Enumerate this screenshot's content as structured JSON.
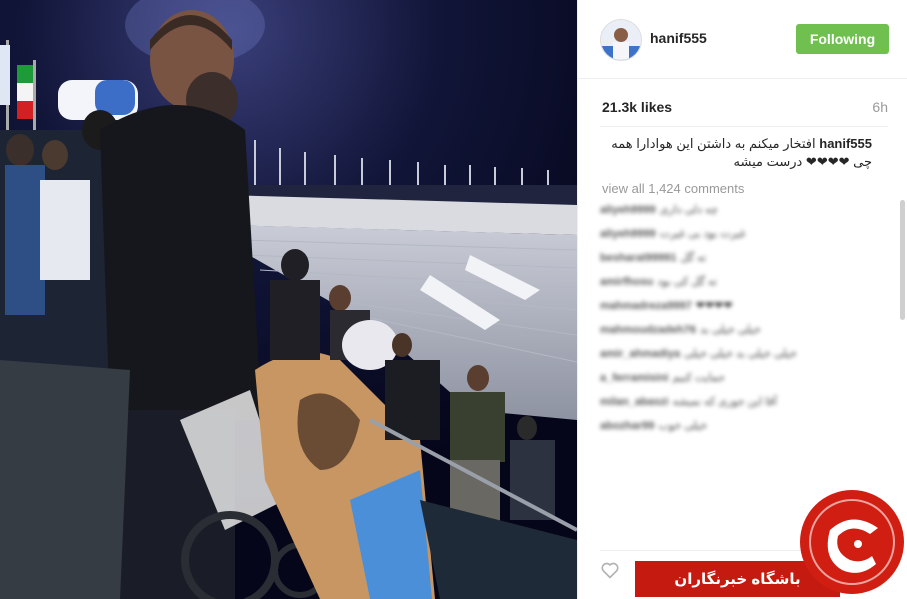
{
  "post": {
    "username": "hanif555",
    "follow_label": "Following",
    "likes": "21.3k likes",
    "age": "6h",
    "caption_user": "hanif555",
    "caption_text": "افتخار میکنم به داشتن این هوادارا همه چی ❤❤❤❤ درست میشه",
    "view_all": "view all 1,424 comments"
  },
  "comments": [
    {
      "user": "aliyeh9999",
      "text": "چه دلی داری"
    },
    {
      "user": "aliyeh9999",
      "text": "غیرت بود بی غیرت"
    },
    {
      "user": "besharat99991",
      "text": "ته گل"
    },
    {
      "user": "amirfhosu",
      "text": "ته گل کی بود"
    },
    {
      "user": "mahmadreza9997",
      "text": "❤❤❤❤"
    },
    {
      "user": "mahmoudzadeh76",
      "text": "خیلی خیلی بد"
    },
    {
      "user": "amir_ahmadiya",
      "text": "خیلی خیلی بد خیلی خیلی"
    },
    {
      "user": "a_ferramisini",
      "text": "حمایت کنیم"
    },
    {
      "user": "milan_abaszi",
      "text": "آقا این جوری که نمیشه"
    },
    {
      "user": "abozhar99",
      "text": "خیلی خوب"
    }
  ],
  "watermark": {
    "text": "باشگاه خبرنگاران"
  },
  "colors": {
    "follow_bg": "#70c050",
    "watermark_red": "#c41a10"
  }
}
